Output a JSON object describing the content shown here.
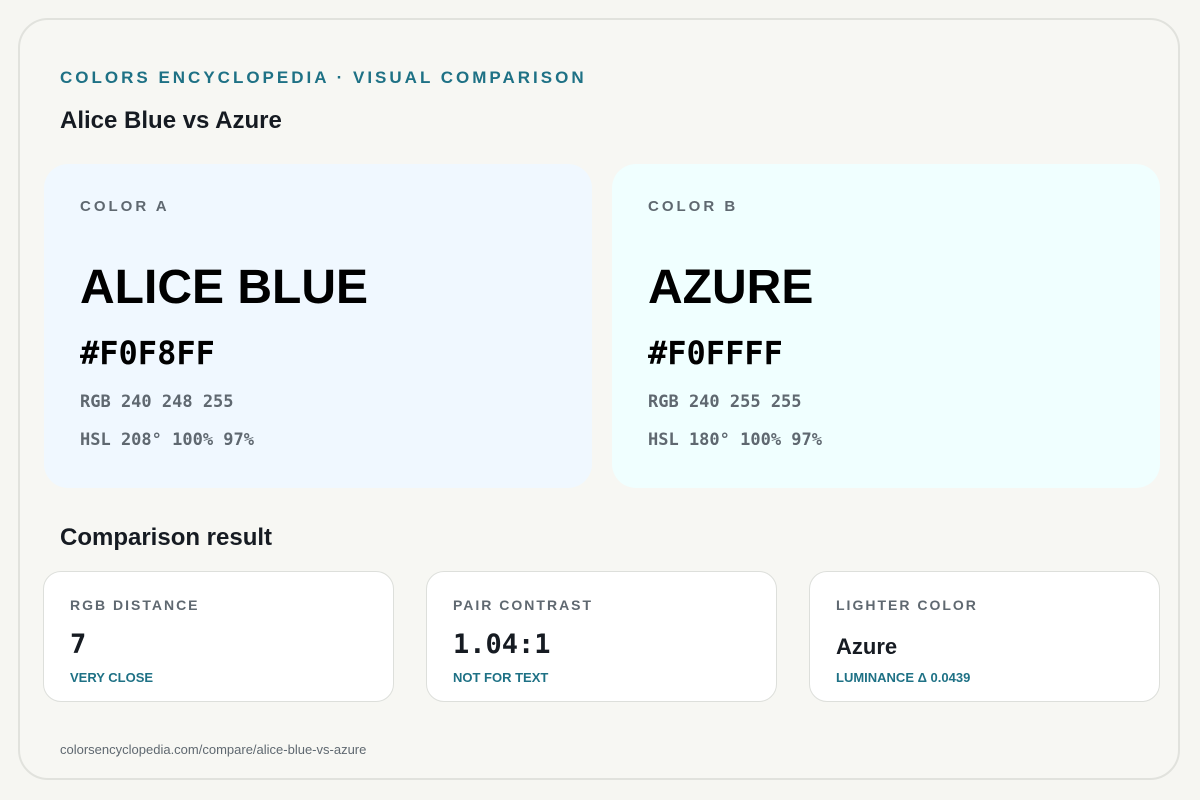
{
  "header": {
    "eyebrow": "COLORS ENCYCLOPEDIA · VISUAL COMPARISON",
    "title": "Alice Blue vs Azure"
  },
  "colors": {
    "accent": "#1E7185",
    "text_dark": "#161B22",
    "text_muted": "#5F6870"
  },
  "color_a": {
    "label": "COLOR A",
    "name": "ALICE BLUE",
    "hex": "#F0F8FF",
    "rgb": "RGB 240 248 255",
    "hsl": "HSL 208° 100% 97%",
    "swatch_color": "#F0F8FF"
  },
  "color_b": {
    "label": "COLOR B",
    "name": "AZURE",
    "hex": "#F0FFFF",
    "rgb": "RGB 240 255 255",
    "hsl": "HSL 180° 100% 97%",
    "swatch_color": "#F0FFFF"
  },
  "comparison": {
    "title": "Comparison result",
    "rgb_distance": {
      "label": "RGB DISTANCE",
      "value": "7",
      "note": "VERY CLOSE"
    },
    "pair_contrast": {
      "label": "PAIR CONTRAST",
      "value": "1.04:1",
      "note": "NOT FOR TEXT"
    },
    "lighter_color": {
      "label": "LIGHTER COLOR",
      "value": "Azure",
      "note": "LUMINANCE Δ 0.0439"
    }
  },
  "footer": {
    "url": "colorsencyclopedia.com/compare/alice-blue-vs-azure"
  }
}
